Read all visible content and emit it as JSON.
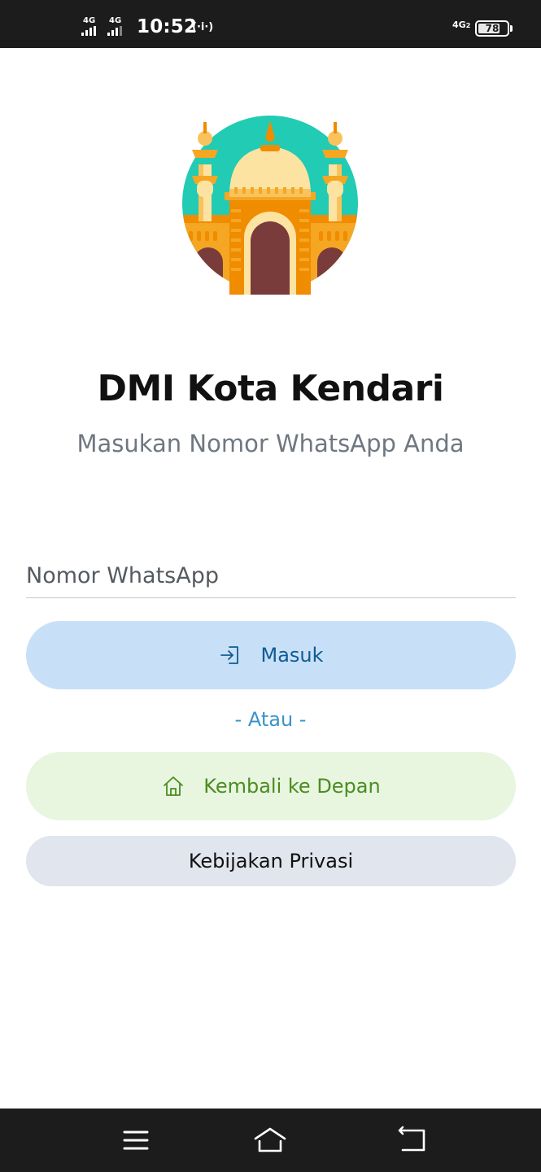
{
  "status_bar": {
    "sim1_network": "4G",
    "sim2_network": "4G",
    "time": "10:52",
    "hotspot_icon": "hotspot-icon",
    "right_network": "4G",
    "right_network_sub": "2",
    "battery_level": "78",
    "battery_fraction": 0.78
  },
  "app": {
    "logo_icon": "mosque-icon",
    "title": "DMI Kota Kendari",
    "subtitle": "Masukan Nomor WhatsApp Anda"
  },
  "form": {
    "phone_placeholder": "Nomor WhatsApp",
    "phone_value": "",
    "login_label": "Masuk",
    "login_icon": "login-icon",
    "separator": "- Atau -",
    "home_label": "Kembali ke Depan",
    "home_icon": "home-icon",
    "privacy_label": "Kebijakan Privasi"
  },
  "colors": {
    "login_bg": "#c8e0f7",
    "login_text": "#0f5b93",
    "home_bg": "#e8f5df",
    "home_text": "#4a8d22",
    "privacy_bg": "#e1e5ee",
    "separator_text": "#3a93c9",
    "logo_circle": "#22cbb3"
  },
  "nav_bar": {
    "menu_icon": "menu-icon",
    "home_icon": "home-nav-icon",
    "back_icon": "back-icon"
  }
}
